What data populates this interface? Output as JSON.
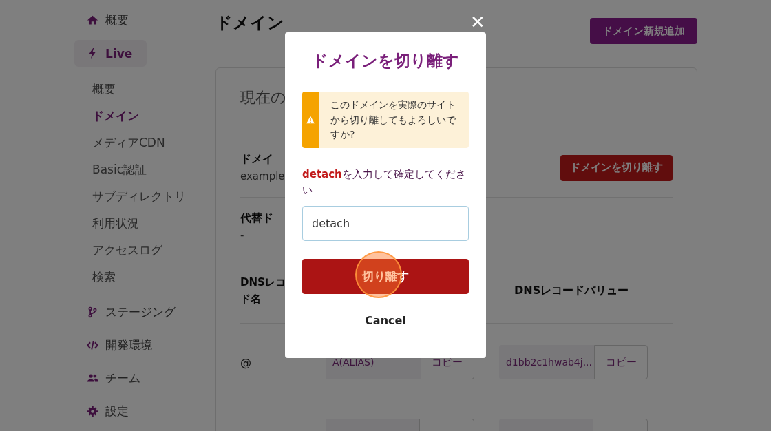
{
  "sidebar": {
    "items": [
      {
        "label": "概要",
        "selected": false
      },
      {
        "label": "Live",
        "selected": true,
        "children": [
          {
            "label": "概要",
            "selected": false
          },
          {
            "label": "ドメイン",
            "selected": true
          },
          {
            "label": "メディアCDN",
            "selected": false
          },
          {
            "label": "Basic認証",
            "selected": false
          },
          {
            "label": "サブディレクトリ",
            "selected": false
          },
          {
            "label": "利用状況",
            "selected": false
          },
          {
            "label": "アクセスログ",
            "selected": false
          },
          {
            "label": "検索",
            "selected": false
          }
        ]
      },
      {
        "label": "ステージング",
        "selected": false
      },
      {
        "label": "開発環境",
        "selected": false
      },
      {
        "label": "チーム",
        "selected": false
      },
      {
        "label": "設定",
        "selected": false
      }
    ]
  },
  "page": {
    "title": "ドメイン",
    "add_button": "ドメイン新規追加"
  },
  "card": {
    "title": "現在の",
    "domain": {
      "label": "ドメイ",
      "value": "example",
      "detach_button": "ドメインを切り離す"
    },
    "alternate": {
      "label": "代替ド",
      "value": "-"
    },
    "dns": {
      "name_header_lines": [
        "DNSレコ",
        "ド名"
      ],
      "value_header": "DNSレコードバリュー",
      "rows": [
        {
          "name": "@",
          "type": "A(ALIAS)",
          "value": "d1bb2c1hwab4j...",
          "copy": [
            "コピー",
            "コピー"
          ]
        }
      ]
    }
  },
  "modal": {
    "title": "ドメインを切り離す",
    "warning": "このドメインを実際のサイトから切り離してもよろしいですか?",
    "prompt": "**detach**を入力して確定してください",
    "input_value": "detach",
    "confirm_button": "切り離す",
    "cancel_button": "Cancel",
    "close_label": "✕"
  }
}
